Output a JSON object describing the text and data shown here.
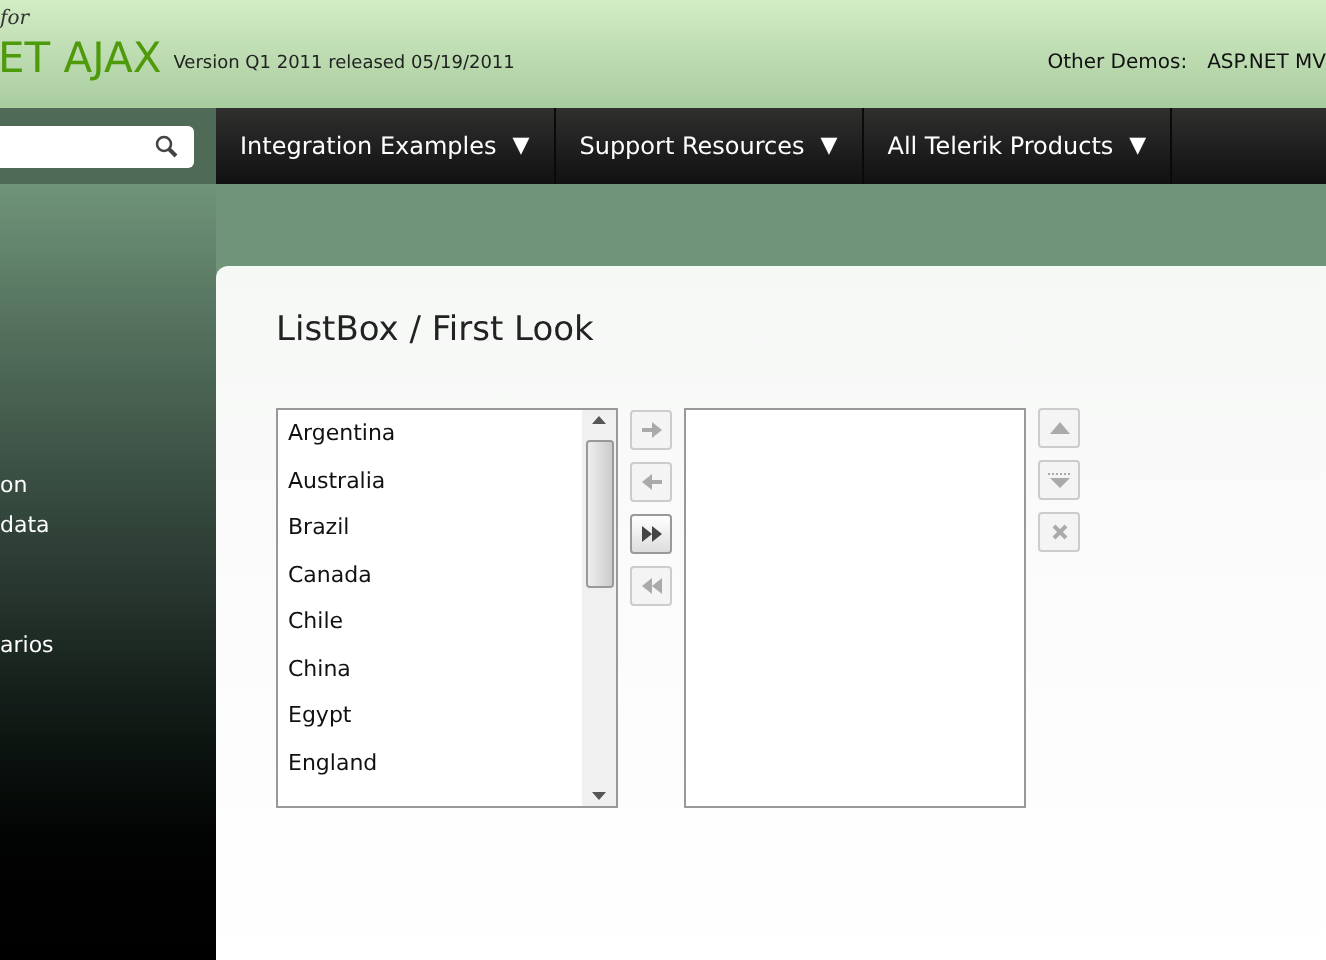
{
  "header": {
    "logo_tagline": "for",
    "logo_text": "ET AJAX",
    "version": "Version Q1 2011 released 05/19/2011",
    "other_demos_label": "Other Demos:",
    "other_demos_link": "ASP.NET MV"
  },
  "nav": {
    "items": [
      {
        "label": "Integration Examples",
        "caret": "▼"
      },
      {
        "label": "Support Resources",
        "caret": "▼"
      },
      {
        "label": "All Telerik Products",
        "caret": "▼"
      }
    ]
  },
  "sidebar": {
    "items": [
      {
        "label": "on"
      },
      {
        "label": "data"
      },
      {
        "label": "arios"
      }
    ]
  },
  "page_title": "ListBox / First Look",
  "source_list": {
    "items": [
      "Argentina",
      "Australia",
      "Brazil",
      "Canada",
      "Chile",
      "China",
      "Egypt",
      "England"
    ]
  },
  "transfer_buttons": [
    {
      "kind": "right",
      "disabled": true
    },
    {
      "kind": "left",
      "disabled": true
    },
    {
      "kind": "all-right",
      "disabled": false
    },
    {
      "kind": "all-left",
      "disabled": true
    }
  ],
  "reorder_buttons": [
    {
      "kind": "up",
      "disabled": true
    },
    {
      "kind": "down",
      "disabled": true
    },
    {
      "kind": "delete",
      "disabled": true
    }
  ]
}
